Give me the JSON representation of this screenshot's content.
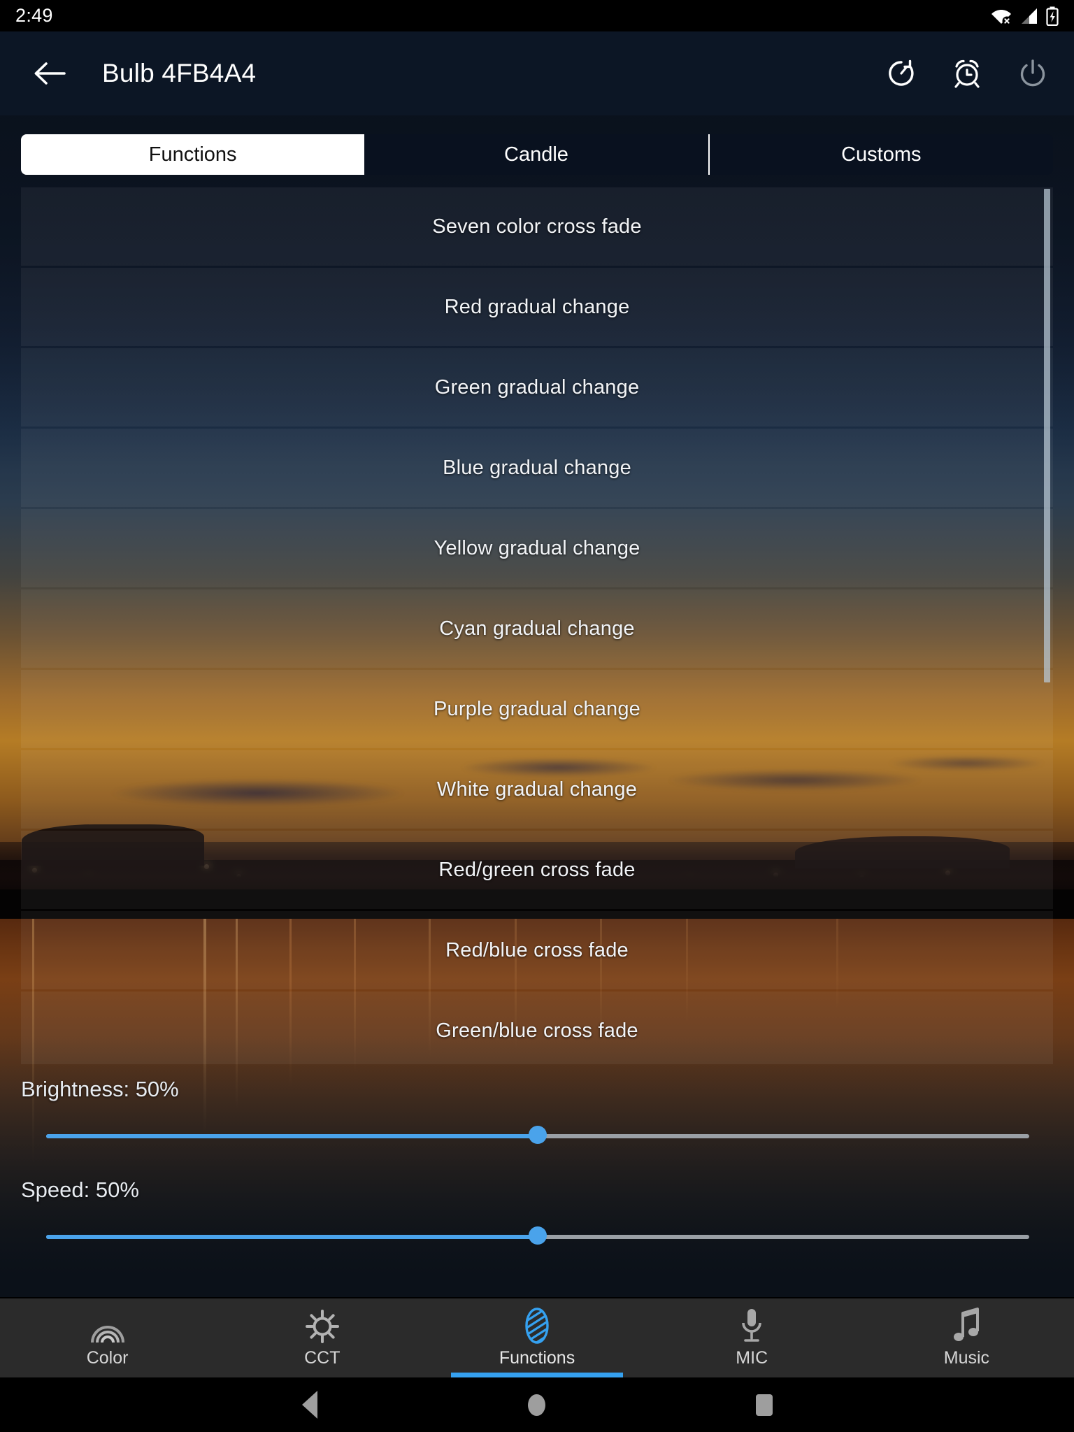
{
  "statusbar": {
    "clock": "2:49",
    "icons": [
      "wifi-no-internet-icon",
      "cellular-signal-icon",
      "battery-charging-icon"
    ]
  },
  "appbar": {
    "back_label": "back-arrow-icon",
    "title": "Bulb  4FB4A4",
    "actions": [
      {
        "name": "timer-icon",
        "label": "Timer"
      },
      {
        "name": "alarm-icon",
        "label": "Alarm"
      },
      {
        "name": "power-icon",
        "label": "Power"
      }
    ]
  },
  "tabs": [
    {
      "label": "Functions",
      "active": true
    },
    {
      "label": "Candle",
      "active": false
    },
    {
      "label": "Customs",
      "active": false
    }
  ],
  "effects": [
    "Seven color cross fade",
    "Red gradual change",
    "Green gradual change",
    "Blue gradual change",
    "Yellow gradual change",
    "Cyan gradual change",
    "Purple gradual change",
    "White gradual change",
    "Red/green cross fade",
    "Red/blue cross fade",
    "Green/blue cross fade"
  ],
  "controls": {
    "brightness": {
      "label": "Brightness: 50%",
      "value": 50
    },
    "speed": {
      "label": "Speed: 50%",
      "value": 50
    }
  },
  "bottomnav": [
    {
      "label": "Color",
      "icon": "rainbow-icon",
      "active": false
    },
    {
      "label": "CCT",
      "icon": "sun-icon",
      "active": false
    },
    {
      "label": "Functions",
      "icon": "striped-oval-icon",
      "active": true
    },
    {
      "label": "MIC",
      "icon": "microphone-icon",
      "active": false
    },
    {
      "label": "Music",
      "icon": "music-note-icon",
      "active": false
    }
  ],
  "androidnav": [
    {
      "name": "android-back-button"
    },
    {
      "name": "android-home-button"
    },
    {
      "name": "android-recents-button"
    }
  ],
  "colors": {
    "accent": "#35a1f0",
    "slider_fill": "#4aa3eb",
    "appbar_bg": "#0c1625",
    "bottomnav_bg": "#2b2b2b",
    "tab_active_bg": "#ffffff"
  }
}
